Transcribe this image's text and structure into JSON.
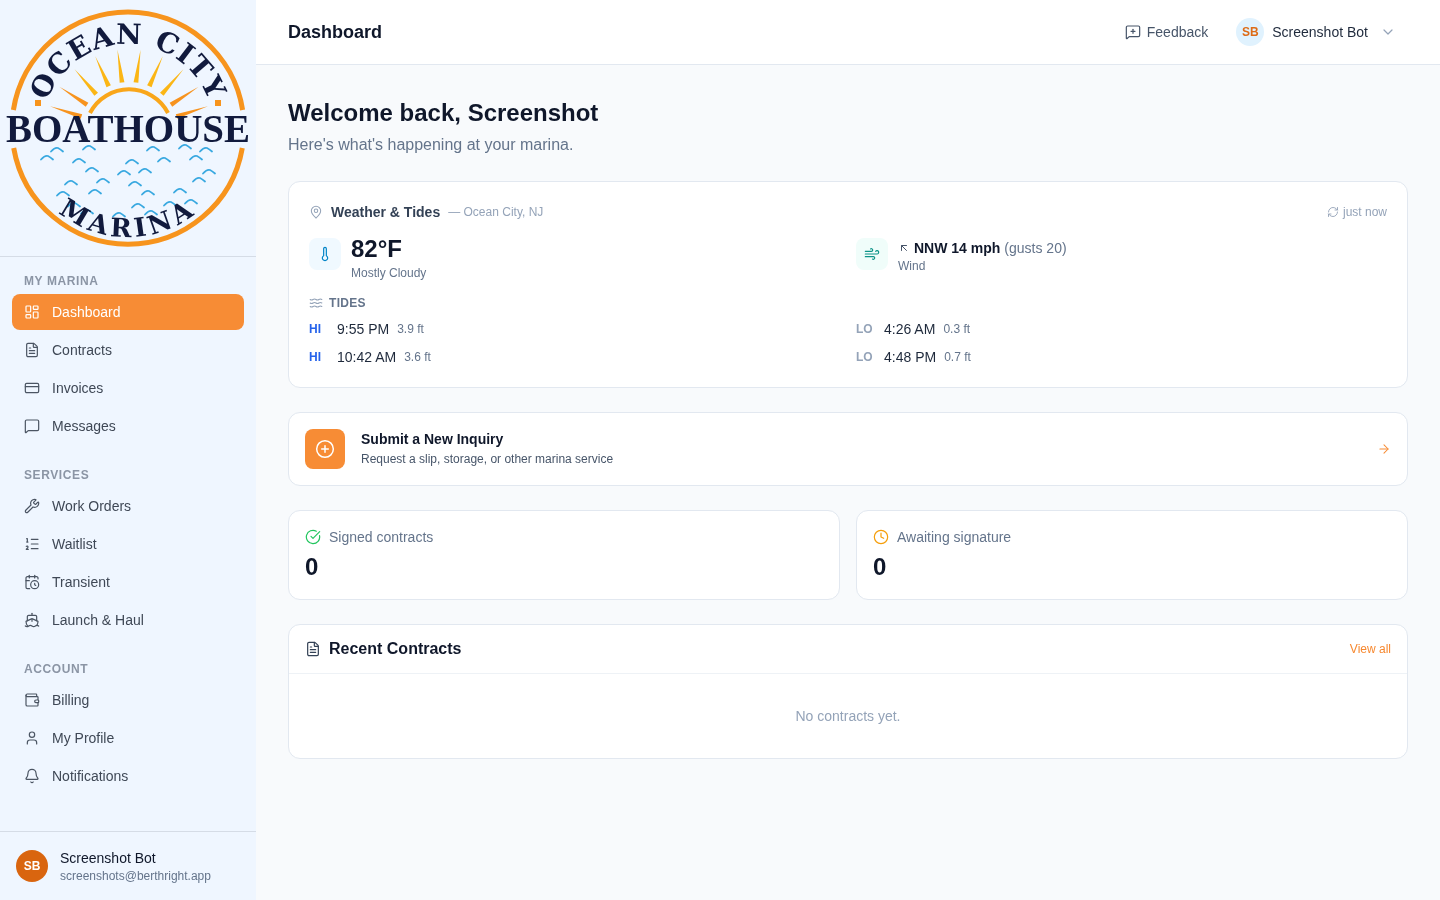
{
  "sidebar": {
    "logo": {
      "top_text": "OCEAN CITY",
      "name": "BOATHOUSE",
      "bottom_text": "MARINA"
    },
    "sections": [
      {
        "title": "MY MARINA",
        "items": [
          {
            "label": "Dashboard",
            "selected": true
          },
          {
            "label": "Contracts",
            "selected": false
          },
          {
            "label": "Invoices",
            "selected": false
          },
          {
            "label": "Messages",
            "selected": false
          }
        ]
      },
      {
        "title": "SERVICES",
        "items": [
          {
            "label": "Work Orders",
            "selected": false
          },
          {
            "label": "Waitlist",
            "selected": false
          },
          {
            "label": "Transient",
            "selected": false
          },
          {
            "label": "Launch & Haul",
            "selected": false
          }
        ]
      },
      {
        "title": "ACCOUNT",
        "items": [
          {
            "label": "Billing",
            "selected": false
          },
          {
            "label": "My Profile",
            "selected": false
          },
          {
            "label": "Notifications",
            "selected": false
          }
        ]
      }
    ],
    "user": {
      "initials": "SB",
      "name": "Screenshot Bot",
      "email": "screenshots@berthright.app"
    }
  },
  "header": {
    "title": "Dashboard",
    "feedback": "Feedback",
    "user": {
      "initials": "SB",
      "name": "Screenshot Bot"
    }
  },
  "welcome": {
    "title": "Welcome back, Screenshot",
    "subtitle": "Here's what's happening at your marina."
  },
  "weather": {
    "title": "Weather & Tides",
    "location": "— Ocean City, NJ",
    "updated": "just now",
    "temperature": "82°F",
    "condition": "Mostly Cloudy",
    "wind": {
      "speed": "NNW 14 mph",
      "gusts": "(gusts 20)",
      "label": "Wind"
    },
    "tides_label": "TIDES",
    "tides": [
      {
        "kind": "high",
        "type": "HI",
        "time": "9:55 PM",
        "height": "3.9 ft"
      },
      {
        "kind": "low",
        "type": "LO",
        "time": "4:26 AM",
        "height": "0.3 ft"
      },
      {
        "kind": "high",
        "type": "HI",
        "time": "10:42 AM",
        "height": "3.6 ft"
      },
      {
        "kind": "low",
        "type": "LO",
        "time": "4:48 PM",
        "height": "0.7 ft"
      }
    ]
  },
  "inquiry": {
    "title": "Submit a New Inquiry",
    "subtitle": "Request a slip, storage, or other marina service"
  },
  "stats": [
    {
      "kind": "signed",
      "label": "Signed contracts",
      "value": "0"
    },
    {
      "kind": "awaiting",
      "label": "Awaiting signature",
      "value": "0"
    }
  ],
  "recent_contracts": {
    "title": "Recent Contracts",
    "link": "View all",
    "empty": "No contracts yet."
  }
}
